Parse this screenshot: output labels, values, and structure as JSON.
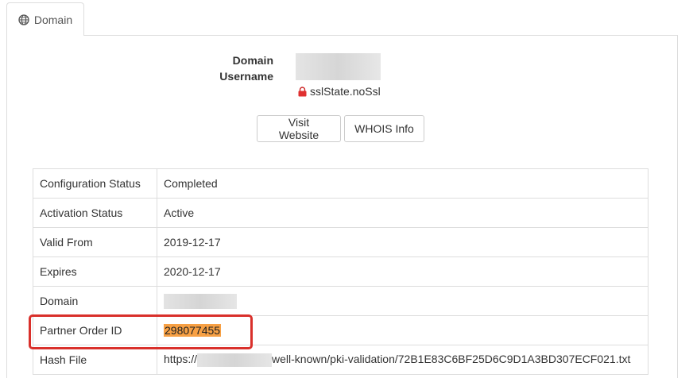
{
  "tab": {
    "label": "Domain",
    "icon": "globe-icon"
  },
  "header": {
    "domain_label": "Domain",
    "username_label": "Username",
    "ssl_state": "sslState.noSsl",
    "ssl_icon": "lock-icon",
    "ssl_icon_color": "#e03030"
  },
  "buttons": {
    "visit_website": "Visit Website",
    "whois_info": "WHOIS Info"
  },
  "details": {
    "rows": [
      {
        "label": "Configuration Status",
        "value": "Completed"
      },
      {
        "label": "Activation Status",
        "value": "Active"
      },
      {
        "label": "Valid From",
        "value": "2019-12-17"
      },
      {
        "label": "Expires",
        "value": "2020-12-17"
      },
      {
        "label": "Domain",
        "value": ""
      },
      {
        "label": "Partner Order ID",
        "value": "298077455"
      },
      {
        "label": "Hash File",
        "value_prefix": "https://",
        "value_suffix": "well-known/pki-validation/72B1E83C6BF25D6C9D1A3BD307ECF021.txt"
      }
    ]
  },
  "colors": {
    "highlight": "#f7a044",
    "annotation": "#d9302b",
    "border": "#dddddd"
  }
}
